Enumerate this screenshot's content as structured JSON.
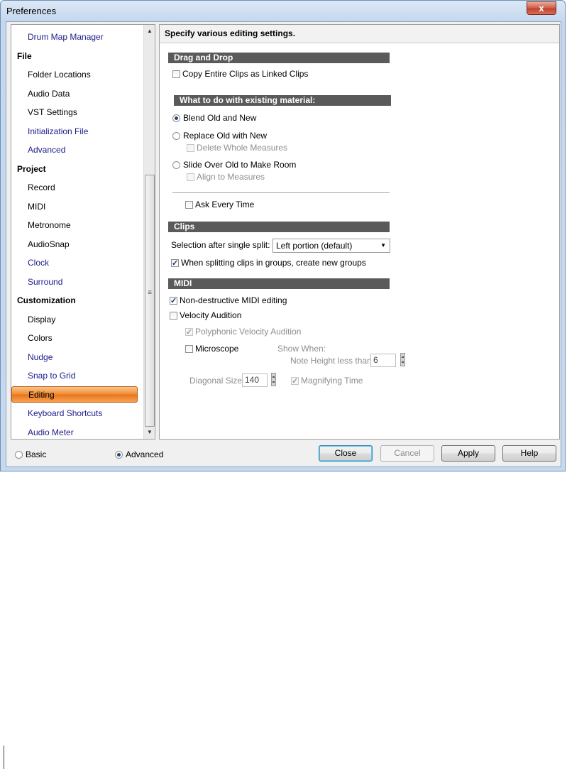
{
  "window": {
    "title": "Preferences",
    "close_glyph": "x"
  },
  "nav": {
    "items": [
      {
        "label": "Drum Map Manager",
        "kind": "sub",
        "link": true
      },
      {
        "label": "File",
        "kind": "category"
      },
      {
        "label": "Folder Locations",
        "kind": "sub"
      },
      {
        "label": "Audio Data",
        "kind": "sub"
      },
      {
        "label": "VST Settings",
        "kind": "sub"
      },
      {
        "label": "Initialization File",
        "kind": "sub",
        "link": true
      },
      {
        "label": "Advanced",
        "kind": "sub",
        "link": true
      },
      {
        "label": "Project",
        "kind": "category"
      },
      {
        "label": "Record",
        "kind": "sub"
      },
      {
        "label": "MIDI",
        "kind": "sub"
      },
      {
        "label": "Metronome",
        "kind": "sub"
      },
      {
        "label": "AudioSnap",
        "kind": "sub"
      },
      {
        "label": "Clock",
        "kind": "sub",
        "link": true
      },
      {
        "label": "Surround",
        "kind": "sub",
        "link": true
      },
      {
        "label": "Customization",
        "kind": "category"
      },
      {
        "label": "Display",
        "kind": "sub"
      },
      {
        "label": "Colors",
        "kind": "sub"
      },
      {
        "label": "Nudge",
        "kind": "sub",
        "link": true
      },
      {
        "label": "Snap to Grid",
        "kind": "sub",
        "link": true
      },
      {
        "label": "Editing",
        "kind": "sub",
        "selected": true
      },
      {
        "label": "Keyboard Shortcuts",
        "kind": "sub",
        "link": true
      },
      {
        "label": "Audio Meter",
        "kind": "sub",
        "link": true
      }
    ],
    "scroll_up": "▲",
    "scroll_down": "▼",
    "scroll_grip": "≡"
  },
  "content": {
    "header": "Specify various editing settings.",
    "drag_drop": {
      "title": "Drag and Drop",
      "copy_linked": {
        "label": "Copy Entire Clips as Linked Clips",
        "checked": false
      },
      "existing_title": "What to do with existing material:",
      "blend": {
        "label": "Blend Old and New",
        "checked": true
      },
      "replace": {
        "label": "Replace Old with New",
        "checked": false
      },
      "delete_whole": {
        "label": "Delete Whole Measures",
        "checked": false,
        "disabled": true
      },
      "slide": {
        "label": "Slide Over Old to Make Room",
        "checked": false
      },
      "align": {
        "label": "Align to Measures",
        "checked": false,
        "disabled": true
      },
      "ask_every_time": {
        "label": "Ask Every Time",
        "checked": false
      }
    },
    "clips": {
      "title": "Clips",
      "split_label": "Selection after single split:",
      "split_value": "Left portion (default)",
      "split_arrow": "▼",
      "new_groups": {
        "label": "When splitting clips in groups, create new groups",
        "checked": true
      }
    },
    "midi": {
      "title": "MIDI",
      "non_destructive": {
        "label": "Non-destructive MIDI editing",
        "checked": true
      },
      "velocity": {
        "label": "Velocity Audition",
        "checked": false
      },
      "polyphonic": {
        "label": "Polyphonic Velocity Audition",
        "checked": true,
        "disabled": true
      },
      "microscope": {
        "label": "Microscope",
        "checked": false
      },
      "show_when": "Show When:",
      "note_height_label": "Note Height less than:",
      "note_height_value": "6",
      "diagonal_label": "Diagonal Size:",
      "diagonal_value": "140",
      "magnifying": {
        "label": "Magnifying Time",
        "checked": true,
        "disabled": true
      }
    }
  },
  "footer": {
    "basic": {
      "label": "Basic",
      "checked": false
    },
    "advanced": {
      "label": "Advanced",
      "checked": true
    },
    "close": "Close",
    "cancel": "Cancel",
    "apply": "Apply",
    "help": "Help"
  }
}
